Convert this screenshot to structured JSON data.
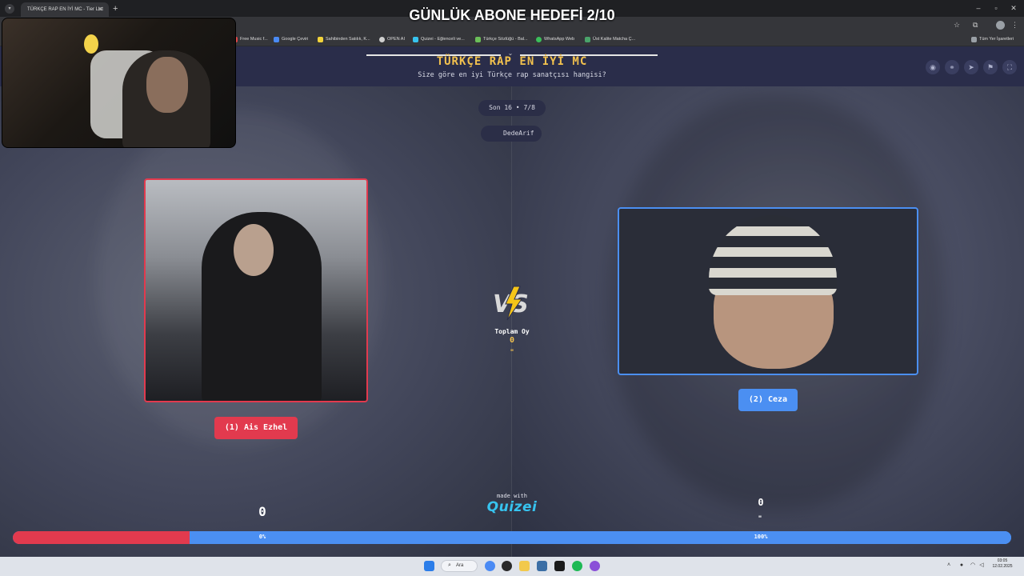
{
  "overlay": {
    "goal_text": "GÜNLÜK ABONE HEDEFİ 2/10"
  },
  "browser": {
    "tab_title": "TÜRKÇE RAP EN İYİ MC - Tier List",
    "tab_close": "✕",
    "new_tab": "+",
    "bookmarks": [
      {
        "label": "Free Music f...",
        "color": "#e04848"
      },
      {
        "label": "Google Çeviri",
        "color": "#4a8af4"
      },
      {
        "label": "Sahibinden Satılık, K...",
        "color": "#f2d33a"
      },
      {
        "label": "OPEN AI",
        "color": "#cfcfcf"
      },
      {
        "label": "Quizei - Eğlenceli ve...",
        "color": "#37c3ef"
      },
      {
        "label": "Türkçe Sözlüğü - Bal...",
        "color": "#6bbf59"
      },
      {
        "label": "WhatsApp Web",
        "color": "#3bbf5a"
      },
      {
        "label": "Üst Kalite Matcha Ç...",
        "color": "#4aa36a"
      }
    ],
    "all_bookmarks": "Tüm Yer İşaretleri"
  },
  "quiz": {
    "title": "TÜRKÇE RAP EN İYİ MC",
    "subtitle": "Size göre en iyi Türkçe rap sanatçısı hangisi?",
    "round": "Son 16 • 7/8",
    "user": "DedeArif",
    "total_votes_label": "Toplam Oy",
    "total_votes_value": "0",
    "total_votes_mark": "\"",
    "left": {
      "button": "(1) Ais Ezhel",
      "count": "0",
      "percent_label": "0%",
      "percent": 0,
      "color": "#e23a4e"
    },
    "right": {
      "button": "(2) Ceza",
      "count": "0",
      "count_mark": "\"",
      "percent_label": "100%",
      "percent": 100,
      "color": "#4b8ff2"
    },
    "made_with": "made with",
    "brand": "Quizei"
  },
  "taskbar": {
    "search_label": "Ara",
    "time": "03:05",
    "date": "12.02.2025"
  }
}
